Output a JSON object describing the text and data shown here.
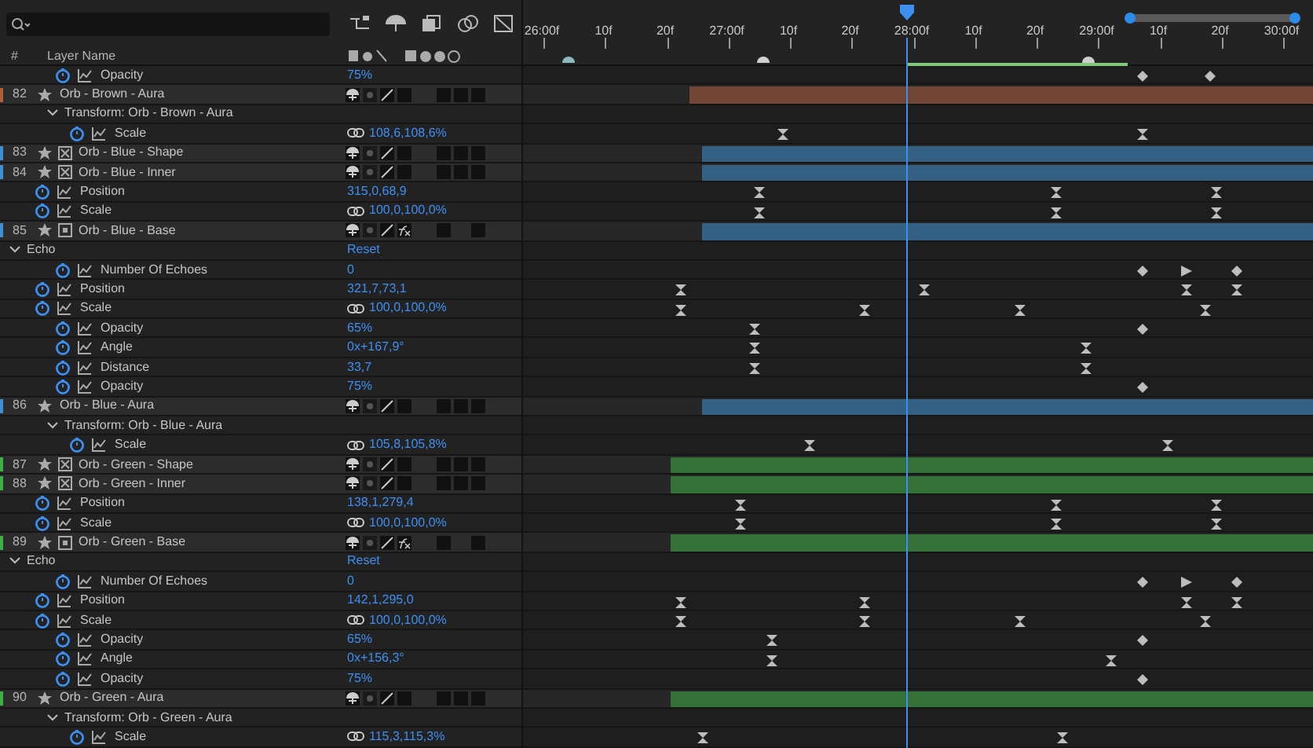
{
  "columns": {
    "number": "#",
    "name": "Layer Name"
  },
  "ruler": {
    "labels": [
      "26:00f",
      "10f",
      "20f",
      "27:00f",
      "10f",
      "20f",
      "28:00f",
      "10f",
      "20f",
      "29:00f",
      "10f",
      "20f",
      "30:00f"
    ]
  },
  "rows": [
    {
      "kind": "effect_property",
      "name": "Opacity",
      "value": "75%"
    },
    {
      "kind": "layer",
      "number": "82",
      "name": "Orb - Brown - Aura",
      "color": "#b0603f",
      "fx": false,
      "children": [
        {
          "kind": "transform_group",
          "name": "Transform: Orb - Brown - Aura",
          "expanded": true,
          "children": [
            {
              "kind": "transform_property",
              "name": "Scale",
              "value": "108,6,108,6%",
              "linked": true
            }
          ]
        }
      ]
    },
    {
      "kind": "shape_layer",
      "number": "83",
      "name": "Orb - Blue - Shape",
      "color": "#3f8fd0",
      "fx": false
    },
    {
      "kind": "shape_layer",
      "number": "84",
      "name": "Orb - Blue - Inner",
      "color": "#3f8fd0",
      "fx": false,
      "children": [
        {
          "kind": "layer_property",
          "name": "Position",
          "value": "315,0,68,9"
        },
        {
          "kind": "layer_property",
          "name": "Scale",
          "value": "100,0,100,0%",
          "linked": true
        }
      ]
    },
    {
      "kind": "solid_layer",
      "number": "85",
      "name": "Orb - Blue - Base",
      "color": "#3f8fd0",
      "fx": true,
      "children": [
        {
          "kind": "effect_group",
          "name": "Echo",
          "value": "Reset",
          "expanded": true,
          "children": [
            {
              "kind": "effect_property",
              "name": "Number Of Echoes",
              "value": "0"
            }
          ]
        },
        {
          "kind": "layer_property",
          "name": "Position",
          "value": "321,7,73,1"
        },
        {
          "kind": "layer_property",
          "name": "Scale",
          "value": "100,0,100,0%",
          "linked": true
        },
        {
          "kind": "effect_property",
          "name": "Opacity",
          "value": "65%"
        },
        {
          "kind": "effect_property",
          "name": "Angle",
          "value": "0x+167,9°"
        },
        {
          "kind": "effect_property",
          "name": "Distance",
          "value": "33,7"
        },
        {
          "kind": "effect_property",
          "name": "Opacity",
          "value": "75%"
        }
      ]
    },
    {
      "kind": "layer",
      "number": "86",
      "name": "Orb - Blue - Aura",
      "color": "#3f8fd0",
      "fx": false,
      "children": [
        {
          "kind": "transform_group",
          "name": "Transform: Orb - Blue - Aura",
          "expanded": true,
          "children": [
            {
              "kind": "transform_property",
              "name": "Scale",
              "value": "105,8,105,8%",
              "linked": true
            }
          ]
        }
      ]
    },
    {
      "kind": "shape_layer",
      "number": "87",
      "name": "Orb - Green - Shape",
      "color": "#3fae48",
      "fx": false
    },
    {
      "kind": "shape_layer",
      "number": "88",
      "name": "Orb - Green - Inner",
      "color": "#3fae48",
      "fx": false,
      "children": [
        {
          "kind": "layer_property",
          "name": "Position",
          "value": "138,1,279,4"
        },
        {
          "kind": "layer_property",
          "name": "Scale",
          "value": "100,0,100,0%",
          "linked": true
        }
      ]
    },
    {
      "kind": "solid_layer",
      "number": "89",
      "name": "Orb - Green - Base",
      "color": "#3fae48",
      "fx": true,
      "children": [
        {
          "kind": "effect_group",
          "name": "Echo",
          "value": "Reset",
          "expanded": true,
          "children": [
            {
              "kind": "effect_property",
              "name": "Number Of Echoes",
              "value": "0"
            }
          ]
        },
        {
          "kind": "layer_property",
          "name": "Position",
          "value": "142,1,295,0"
        },
        {
          "kind": "layer_property",
          "name": "Scale",
          "value": "100,0,100,0%",
          "linked": true
        },
        {
          "kind": "effect_property",
          "name": "Opacity",
          "value": "65%"
        },
        {
          "kind": "effect_property",
          "name": "Angle",
          "value": "0x+156,3°"
        },
        {
          "kind": "effect_property",
          "name": "Opacity",
          "value": "75%"
        }
      ]
    },
    {
      "kind": "layer",
      "number": "90",
      "name": "Orb - Green - Aura",
      "color": "#3fae48",
      "fx": false,
      "children": [
        {
          "kind": "transform_group",
          "name": "Transform: Orb - Green - Aura",
          "expanded": true,
          "children": [
            {
              "kind": "transform_property",
              "name": "Scale",
              "value": "115,3,115,3%",
              "linked": true
            }
          ]
        }
      ]
    }
  ]
}
